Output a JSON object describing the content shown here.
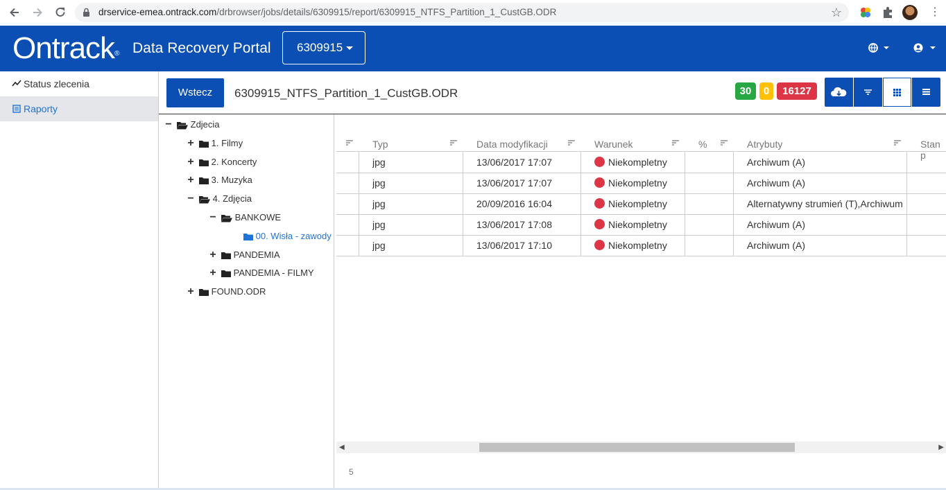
{
  "browser": {
    "url_host": "drservice-emea.ontrack.com",
    "url_path": "/drbrowser/jobs/details/6309915/report/6309915_NTFS_Partition_1_CustGB.ODR"
  },
  "header": {
    "logo": "Ontrack",
    "logo_mark": "®",
    "portal_title": "Data Recovery Portal",
    "job_number": "6309915",
    "brand_color": "#0b4fb5"
  },
  "sidebar": {
    "items": [
      {
        "label": "Status zlecenia",
        "icon": "chart-line-icon"
      },
      {
        "label": "Raporty",
        "icon": "list-icon"
      }
    ]
  },
  "toolbar": {
    "back_label": "Wstecz",
    "report_title": "6309915_NTFS_Partition_1_CustGB.ODR",
    "badges": [
      {
        "value": "30",
        "color": "#28a745"
      },
      {
        "value": "0",
        "color": "#ffc107"
      },
      {
        "value": "16127",
        "color": "#dc3545"
      }
    ]
  },
  "tree": {
    "nodes": [
      {
        "label": "Zdjecia",
        "toggle": "−",
        "open": true
      },
      {
        "label": "1. Filmy",
        "toggle": "+",
        "open": false
      },
      {
        "label": "2. Koncerty",
        "toggle": "+",
        "open": false
      },
      {
        "label": "3. Muzyka",
        "toggle": "+",
        "open": false
      },
      {
        "label": "4. Zdjęcia",
        "toggle": "−",
        "open": true
      },
      {
        "label": "BANKOWE",
        "toggle": "−",
        "open": true
      },
      {
        "label": "00. Wisła - zawody",
        "toggle": "",
        "open": false
      },
      {
        "label": "PANDEMIA",
        "toggle": "+",
        "open": false
      },
      {
        "label": "PANDEMIA - FILMY",
        "toggle": "+",
        "open": false
      },
      {
        "label": "FOUND.ODR",
        "toggle": "+",
        "open": false
      }
    ]
  },
  "grid": {
    "columns": [
      "Typ",
      "Data modyfikacji",
      "Warunek",
      "%",
      "Atrybuty",
      "Stan p"
    ],
    "rows": [
      {
        "type": "jpg",
        "modified": "13/06/2017 17:07",
        "condition": "Niekompletny",
        "percent": "",
        "attributes": "Archiwum (A)"
      },
      {
        "type": "jpg",
        "modified": "13/06/2017 17:07",
        "condition": "Niekompletny",
        "percent": "",
        "attributes": "Archiwum (A)"
      },
      {
        "type": "jpg",
        "modified": "20/09/2016 16:04",
        "condition": "Niekompletny",
        "percent": "",
        "attributes": "Alternatywny strumień (T),Archiwum"
      },
      {
        "type": "jpg",
        "modified": "13/06/2017 17:08",
        "condition": "Niekompletny",
        "percent": "",
        "attributes": "Archiwum (A)"
      },
      {
        "type": "jpg",
        "modified": "13/06/2017 17:10",
        "condition": "Niekompletny",
        "percent": "",
        "attributes": "Archiwum (A)"
      }
    ],
    "row_count": "5",
    "condition_color": "#dc3545"
  }
}
